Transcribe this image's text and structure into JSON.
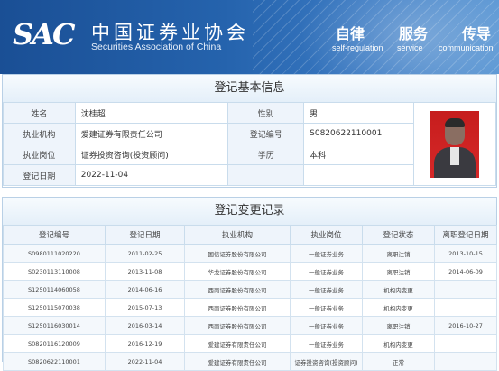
{
  "header": {
    "logo_text": "SAC",
    "org_name_cn": "中国证券业协会",
    "org_name_en": "Securities Association of China",
    "slogans": [
      {
        "cn": "自律",
        "en": "self-regulation"
      },
      {
        "cn": "服务",
        "en": "service"
      },
      {
        "cn": "传导",
        "en": "communication"
      }
    ]
  },
  "basic_info": {
    "title": "登记基本信息",
    "name_label": "姓名",
    "name_value": "沈桂超",
    "gender_label": "性别",
    "gender_value": "男",
    "org_label": "执业机构",
    "org_value": "爱建证券有限责任公司",
    "reg_no_label": "登记编号",
    "reg_no_value": "S0820622110001",
    "position_label": "执业岗位",
    "position_value": "证券投资咨询(投资顾问)",
    "education_label": "学历",
    "education_value": "本科",
    "reg_date_label": "登记日期",
    "reg_date_value": "2022-11-04"
  },
  "change_records": {
    "title": "登记变更记录",
    "columns": [
      "登记编号",
      "登记日期",
      "执业机构",
      "执业岗位",
      "登记状态",
      "离职登记日期"
    ],
    "rows": [
      [
        "S0980111020220",
        "2011-02-25",
        "国信证券股份有限公司",
        "一般证券业务",
        "离职注销",
        "2013-10-15"
      ],
      [
        "S0230113110008",
        "2013-11-08",
        "华龙证券股份有限公司",
        "一般证券业务",
        "离职注销",
        "2014-06-09"
      ],
      [
        "S1250114060058",
        "2014-06-16",
        "西南证券股份有限公司",
        "一般证券业务",
        "机构内变更",
        ""
      ],
      [
        "S1250115070038",
        "2015-07-13",
        "西南证券股份有限公司",
        "一般证券业务",
        "机构内变更",
        ""
      ],
      [
        "S1250116030014",
        "2016-03-14",
        "西南证券股份有限公司",
        "一般证券业务",
        "离职注销",
        "2016-10-27"
      ],
      [
        "S0820116120009",
        "2016-12-19",
        "爱建证券有限责任公司",
        "一般证券业务",
        "机构内变更",
        ""
      ],
      [
        "S0820622110001",
        "2022-11-04",
        "爱建证券有限责任公司",
        "证券投资咨询(投资顾问)",
        "正常",
        ""
      ]
    ]
  }
}
